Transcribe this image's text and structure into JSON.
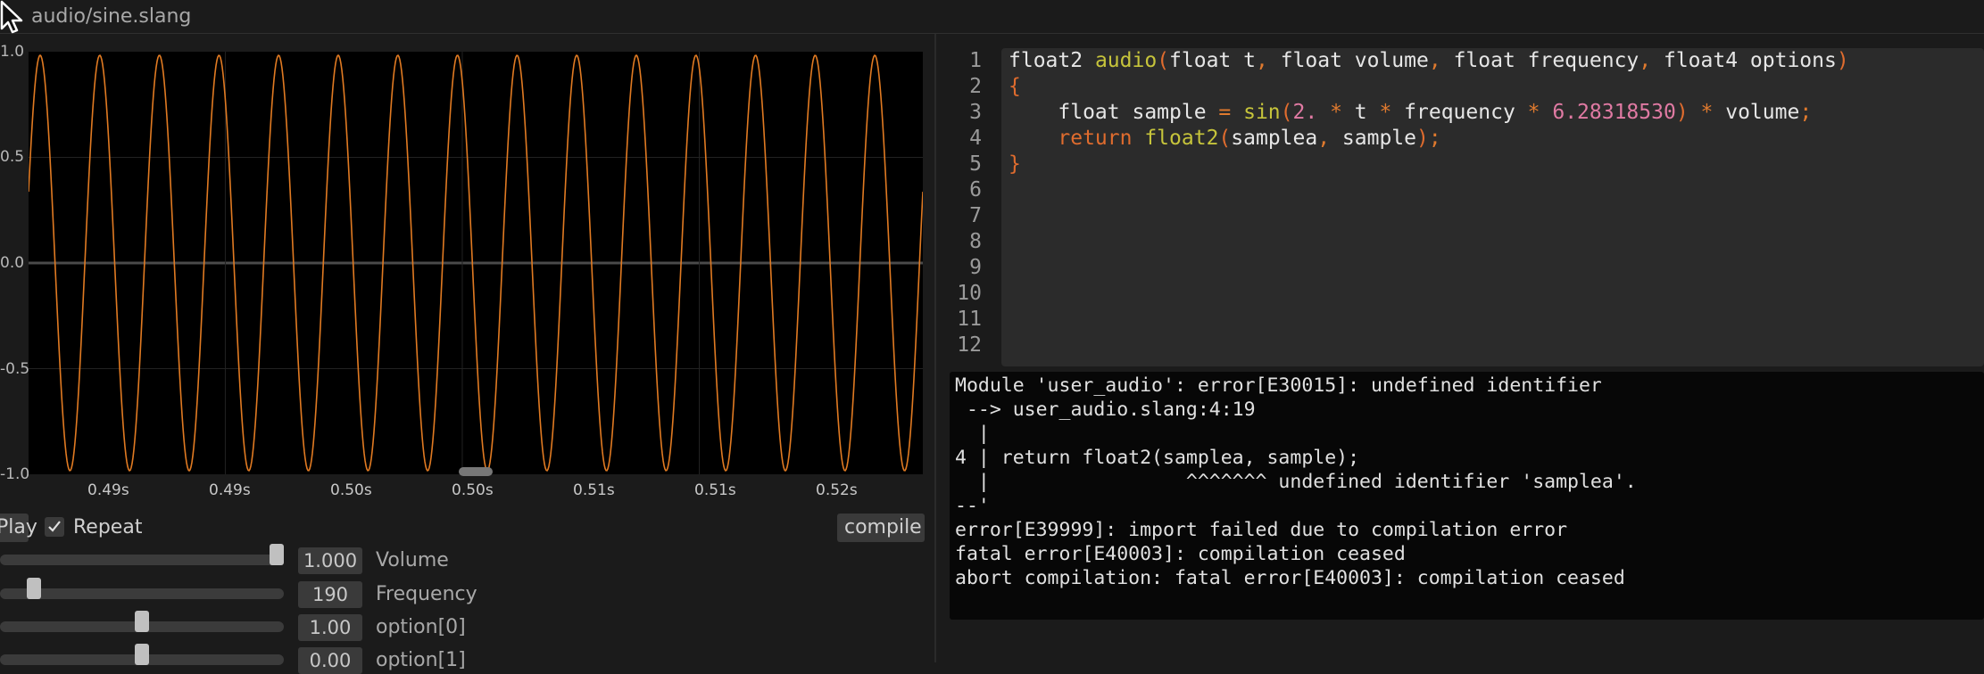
{
  "window": {
    "title": "audio/sine.slang"
  },
  "plot": {
    "y_ticks": [
      "1.0",
      "0.5",
      "0.0",
      "-0.5",
      "-1.0"
    ],
    "x_ticks": [
      "0.49s",
      "0.49s",
      "0.50s",
      "0.50s",
      "0.51s",
      "0.51s",
      "0.52s"
    ],
    "waveform_color": "#e07a22",
    "waveform_cycles_visible": 15
  },
  "controls": {
    "play_label": "Play",
    "repeat_label": "Repeat",
    "repeat_checked": true,
    "compile_label": "compile"
  },
  "params": [
    {
      "value": "1.000",
      "label": "Volume",
      "level": 1.0
    },
    {
      "value": "190",
      "label": "Frequency",
      "level": 0.1
    },
    {
      "value": "1.00",
      "label": "option[0]",
      "level": 0.5
    },
    {
      "value": "0.00",
      "label": "option[1]",
      "level": 0.5
    }
  ],
  "editor": {
    "line_numbers": [
      "1",
      "2",
      "3",
      "4",
      "5",
      "6",
      "7",
      "8",
      "9",
      "10",
      "11",
      "12"
    ]
  },
  "console": {
    "lines": [
      "Module 'user_audio': error[E30015]: undefined identifier",
      " --> user_audio.slang:4:19",
      "  |",
      "4 | return float2(samplea, sample);",
      "  |                 ^^^^^^^ undefined identifier 'samplea'.",
      "--'",
      "error[E39999]: import failed due to compilation error",
      "fatal error[E40003]: compilation ceased",
      "abort compilation: fatal error[E40003]: compilation ceased"
    ]
  }
}
